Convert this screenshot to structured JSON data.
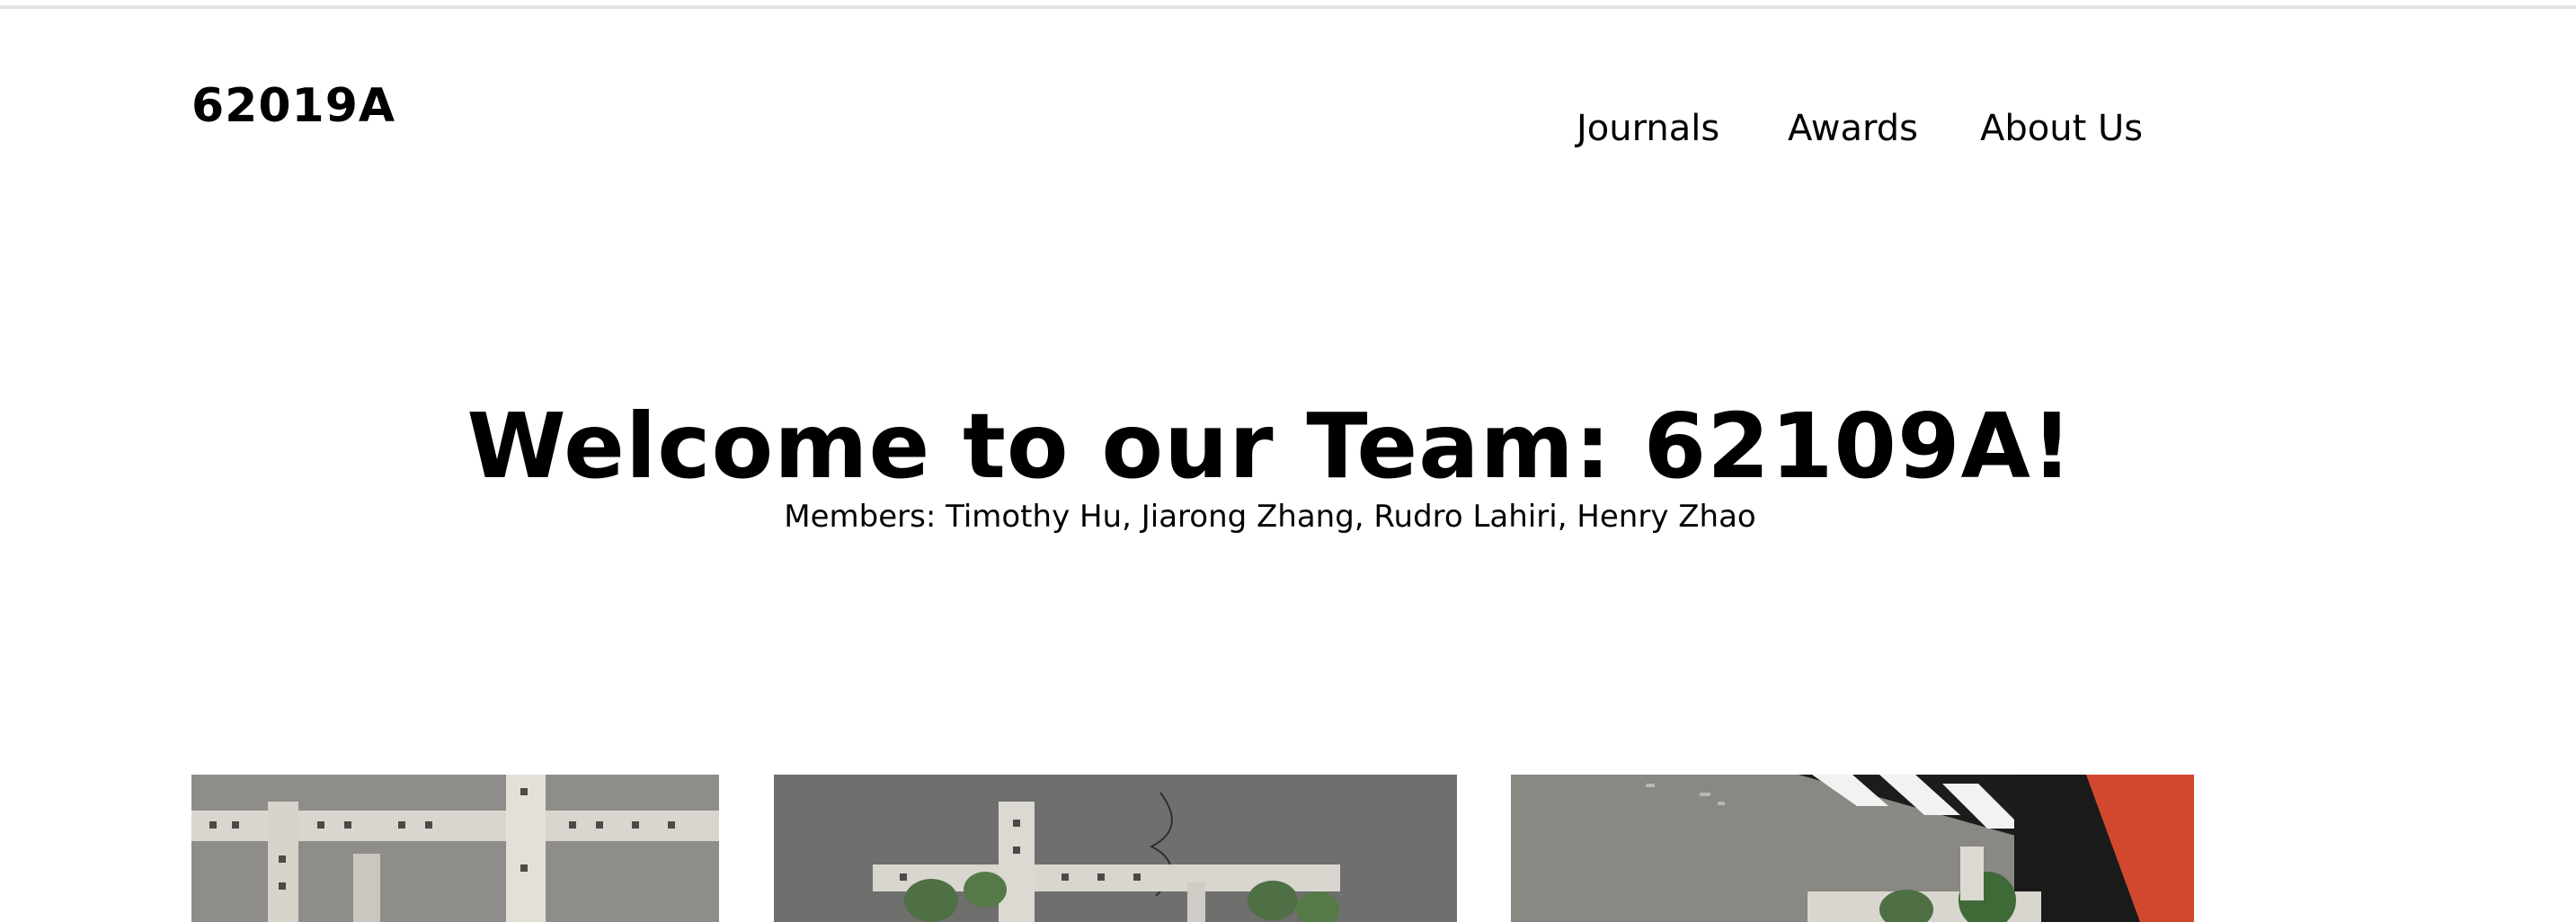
{
  "header": {
    "logo": "62019A",
    "nav": [
      {
        "label": "Journals"
      },
      {
        "label": "Awards"
      },
      {
        "label": "About Us"
      }
    ]
  },
  "hero": {
    "title": "Welcome to our Team: 62109A!",
    "members": "Members: Timothy Hu, Jiarong Zhang, Rudro Lahiri, Henry Zhao"
  },
  "gallery": [
    {
      "subject": "robot-frame-photo"
    },
    {
      "subject": "robot-intake-photo"
    },
    {
      "subject": "robot-field-photo"
    }
  ],
  "colors": {
    "background": "#ffffff",
    "text": "#000000",
    "rule": "#e3e3e3",
    "photo_metal": "#d9d6cf",
    "photo_wheel": "#4f6f44",
    "photo_red": "#d2482f"
  }
}
